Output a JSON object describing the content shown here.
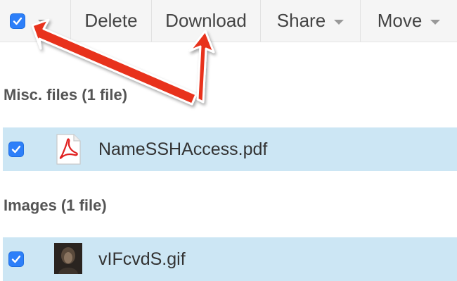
{
  "toolbar": {
    "delete_label": "Delete",
    "download_label": "Download",
    "share_label": "Share",
    "move_label": "Move"
  },
  "sections": [
    {
      "title": "Misc. files (1 file)",
      "file": {
        "name": "NameSSHAccess.pdf",
        "icon": "pdf-file-icon",
        "selected": true
      }
    },
    {
      "title": "Images (1 file)",
      "file": {
        "name": "vIFcvdS.gif",
        "icon": "image-thumbnail",
        "selected": true
      }
    }
  ],
  "colors": {
    "selected_row": "#cce6f4",
    "checkbox": "#2d7ff9",
    "annotation_arrow": "#e8321e"
  }
}
